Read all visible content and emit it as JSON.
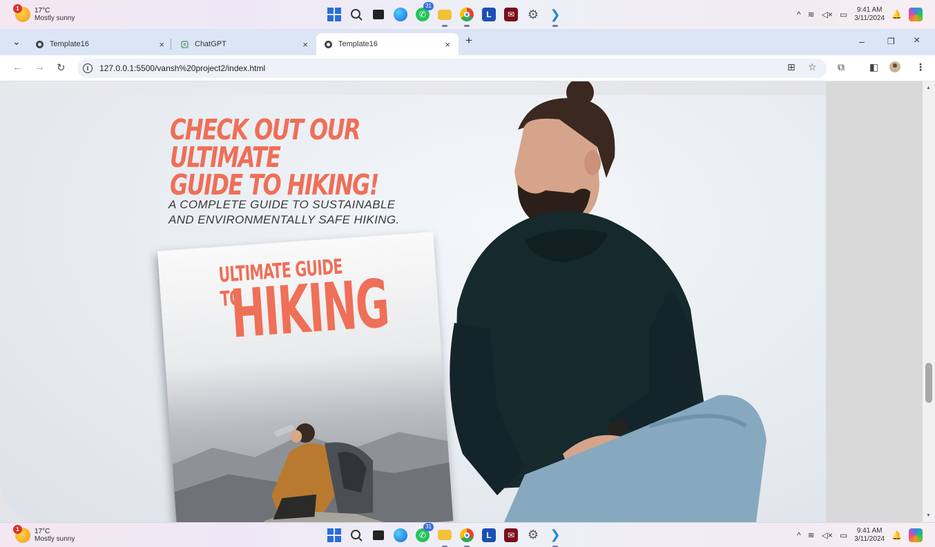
{
  "taskbar": {
    "weather": {
      "temp": "17°C",
      "condition": "Mostly sunny",
      "badge": "1"
    },
    "whatsapp_badge": "31",
    "clock": {
      "time": "9:41 AM",
      "date": "3/11/2024"
    }
  },
  "browser": {
    "tabs": [
      {
        "label": "Template16",
        "active": false
      },
      {
        "label": "ChatGPT",
        "active": false
      },
      {
        "label": "Template16",
        "active": true
      }
    ],
    "url": "127.0.0.1:5500/vansh%20project2/index.html"
  },
  "page": {
    "headline_line1": "CHECK OUT OUR ULTIMATE",
    "headline_line2": "GUIDE TO HIKING!",
    "subline_line1": "A COMPLETE GUIDE TO SUSTAINABLE",
    "subline_line2": "AND ENVIRONMENTALLY SAFE HIKING.",
    "book_title_small": "ULTIMATE GUIDE TO",
    "book_title_big": "HIKING"
  },
  "colors": {
    "accent": "#ef6f58",
    "hoodie": "#16292c",
    "jeans": "#87a9bf"
  }
}
